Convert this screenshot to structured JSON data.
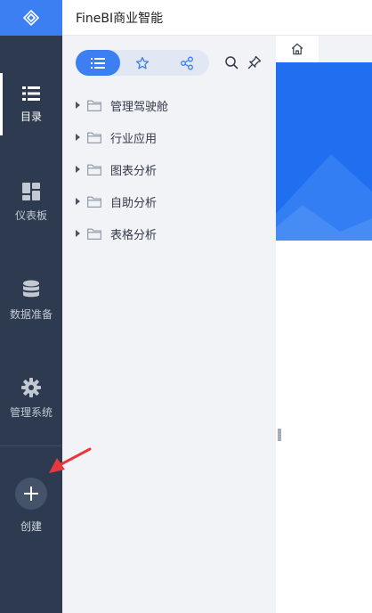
{
  "app": {
    "title": "FineBI商业智能"
  },
  "nav": {
    "items": [
      {
        "label": "目录",
        "icon": "catalog-list-icon",
        "active": true
      },
      {
        "label": "仪表板",
        "icon": "dashboard-grid-icon",
        "active": false
      },
      {
        "label": "数据准备",
        "icon": "database-icon",
        "active": false
      },
      {
        "label": "管理系统",
        "icon": "gear-icon",
        "active": false
      }
    ],
    "create": {
      "label": "创建",
      "icon": "plus-icon"
    }
  },
  "catalog": {
    "view_tabs": [
      {
        "icon": "list-icon",
        "active": true
      },
      {
        "icon": "star-icon",
        "active": false
      },
      {
        "icon": "share-icon",
        "active": false
      }
    ],
    "tools": [
      "search-icon",
      "pin-icon"
    ],
    "folders": [
      {
        "label": "管理驾驶舱"
      },
      {
        "label": "行业应用"
      },
      {
        "label": "图表分析"
      },
      {
        "label": "自助分析"
      },
      {
        "label": "表格分析"
      }
    ]
  },
  "content": {
    "tabs": [
      {
        "icon": "home-icon"
      }
    ]
  },
  "colors": {
    "accent": "#3b7ff3",
    "rail": "#2d3a4f",
    "panel": "#f2f3f7",
    "annotation": "#e8383d"
  }
}
